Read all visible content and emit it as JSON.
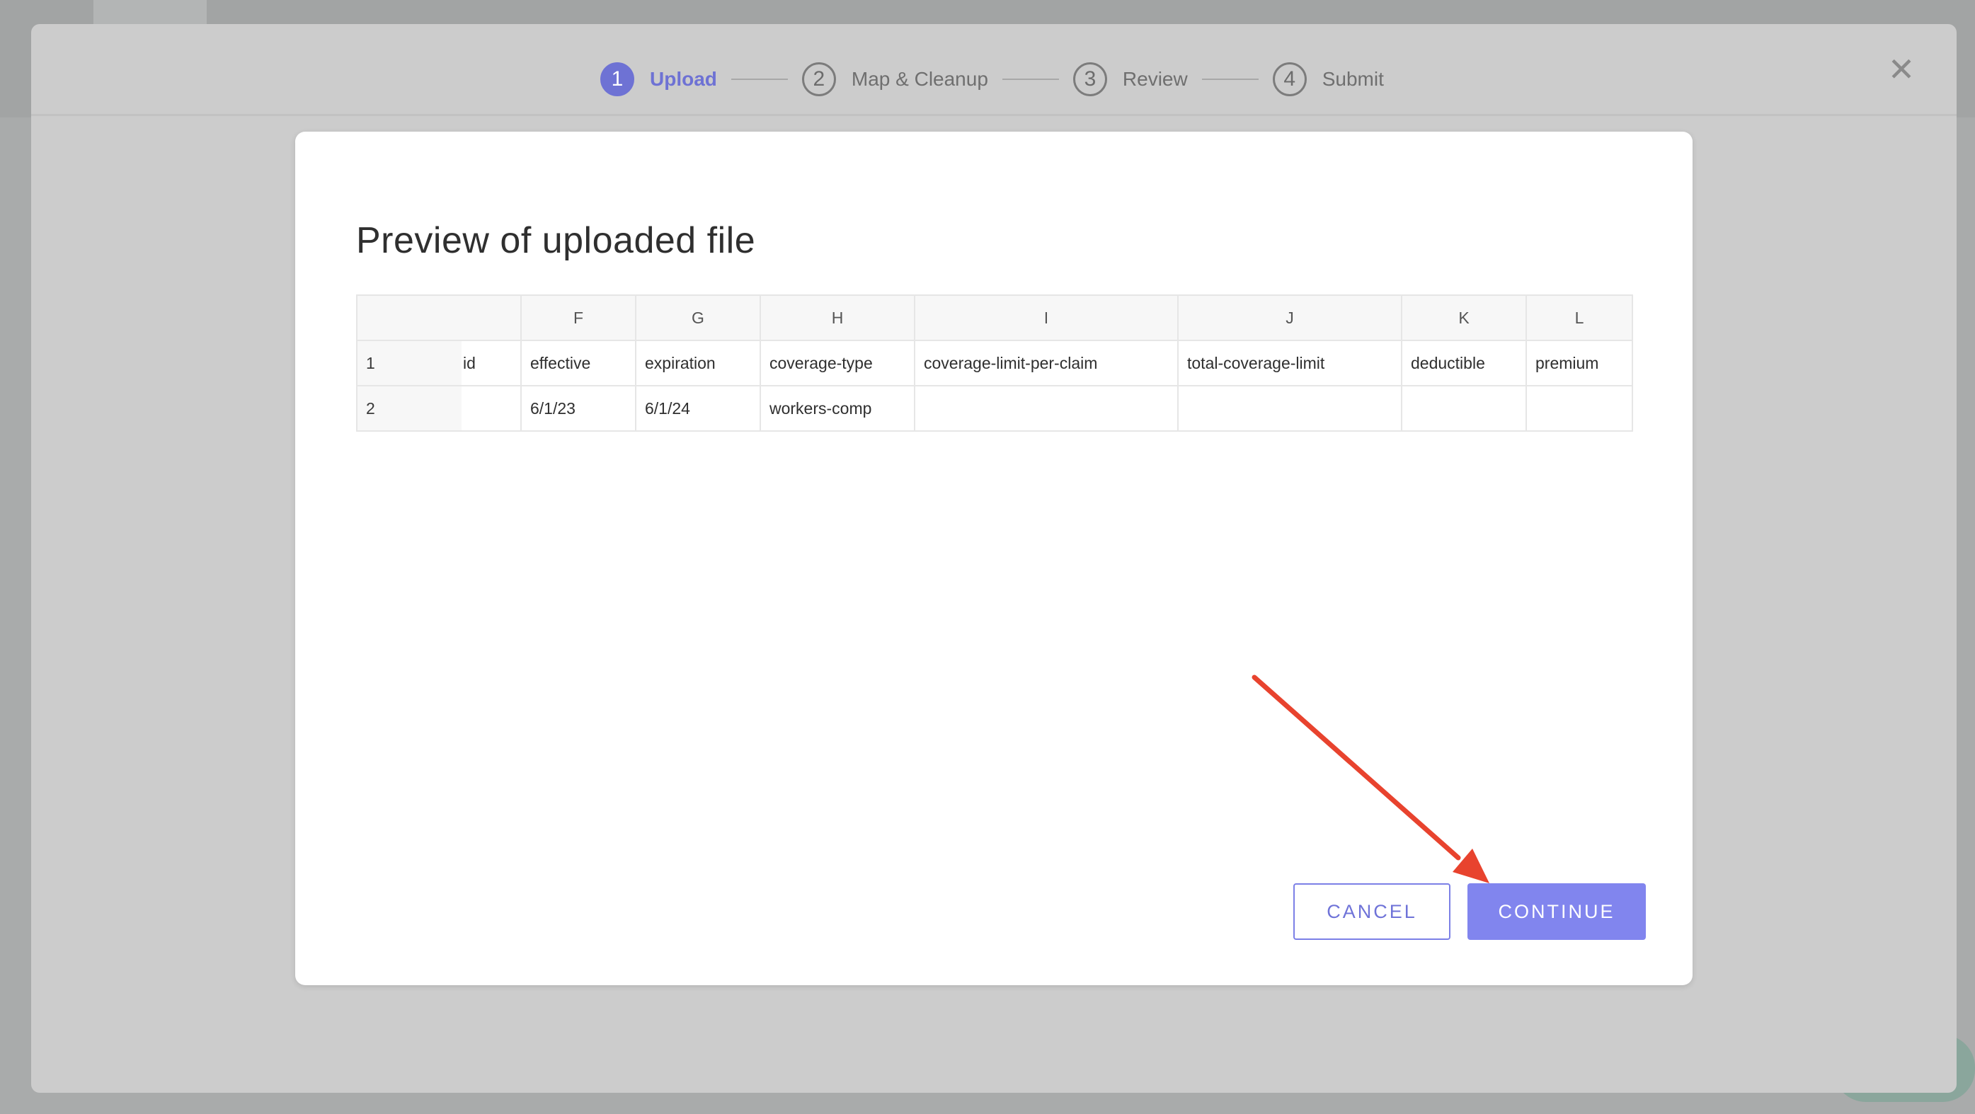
{
  "stepper": {
    "steps": [
      {
        "number": "1",
        "label": "Upload",
        "active": true
      },
      {
        "number": "2",
        "label": "Map & Cleanup",
        "active": false
      },
      {
        "number": "3",
        "label": "Review",
        "active": false
      },
      {
        "number": "4",
        "label": "Submit",
        "active": false
      }
    ],
    "close_icon": "close-icon",
    "close_glyph": "✕"
  },
  "modal": {
    "title": "Preview of uploaded file"
  },
  "preview_table": {
    "column_letters": [
      "F",
      "G",
      "H",
      "I",
      "J",
      "K",
      "L"
    ],
    "rows": [
      {
        "num": "1",
        "cells": [
          "id",
          "effective",
          "expiration",
          "coverage-type",
          "coverage-limit-per-claim",
          "total-coverage-limit",
          "deductible",
          "premium"
        ]
      },
      {
        "num": "2",
        "cells": [
          "",
          "6/1/23",
          "6/1/24",
          "workers-comp",
          "",
          "",
          "",
          ""
        ]
      }
    ]
  },
  "actions": {
    "cancel_label": "CANCEL",
    "continue_label": "CONTINUE"
  },
  "colors": {
    "accent": "#6e72d4",
    "primary_button": "#8185ee",
    "annotation_arrow": "#e8432e"
  }
}
